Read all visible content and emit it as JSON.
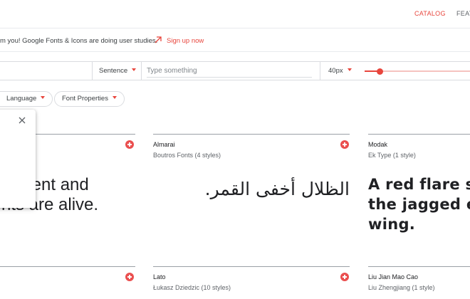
{
  "nav": {
    "catalog": "CATALOG",
    "feat": "FEAT"
  },
  "banner": {
    "text": "m you! Google Fonts & Icons are doing user studies.",
    "link": "Sign up now"
  },
  "toolbar": {
    "preview_mode": "Sentence",
    "input_placeholder": "Type something",
    "font_size": "40px",
    "font_size_level": 0.14
  },
  "filters": {
    "language": "Language",
    "font_properties": "Font Properties"
  },
  "fonts": [
    {
      "name": "",
      "designer": "",
      "sample_lines": [
        "ipment and",
        "nts are alive."
      ]
    },
    {
      "name": "Almarai",
      "designer": "Boutros Fonts (4 styles)",
      "sample": "الظلال أخفى القمر."
    },
    {
      "name": "Modak",
      "designer": "Ek Type (1 style)",
      "sample_lines": [
        "A red flare s",
        "the jagged e",
        "wing."
      ]
    },
    {
      "name": "",
      "designer": ""
    },
    {
      "name": "Lato",
      "designer": "Łukasz Dziedzic (10 styles)"
    },
    {
      "name": "Liu Jian Mao Cao",
      "designer": "Liu Zhengjiang (1 style)"
    }
  ],
  "colors": {
    "accent": "#e8453c",
    "divider": "#dadce0"
  }
}
